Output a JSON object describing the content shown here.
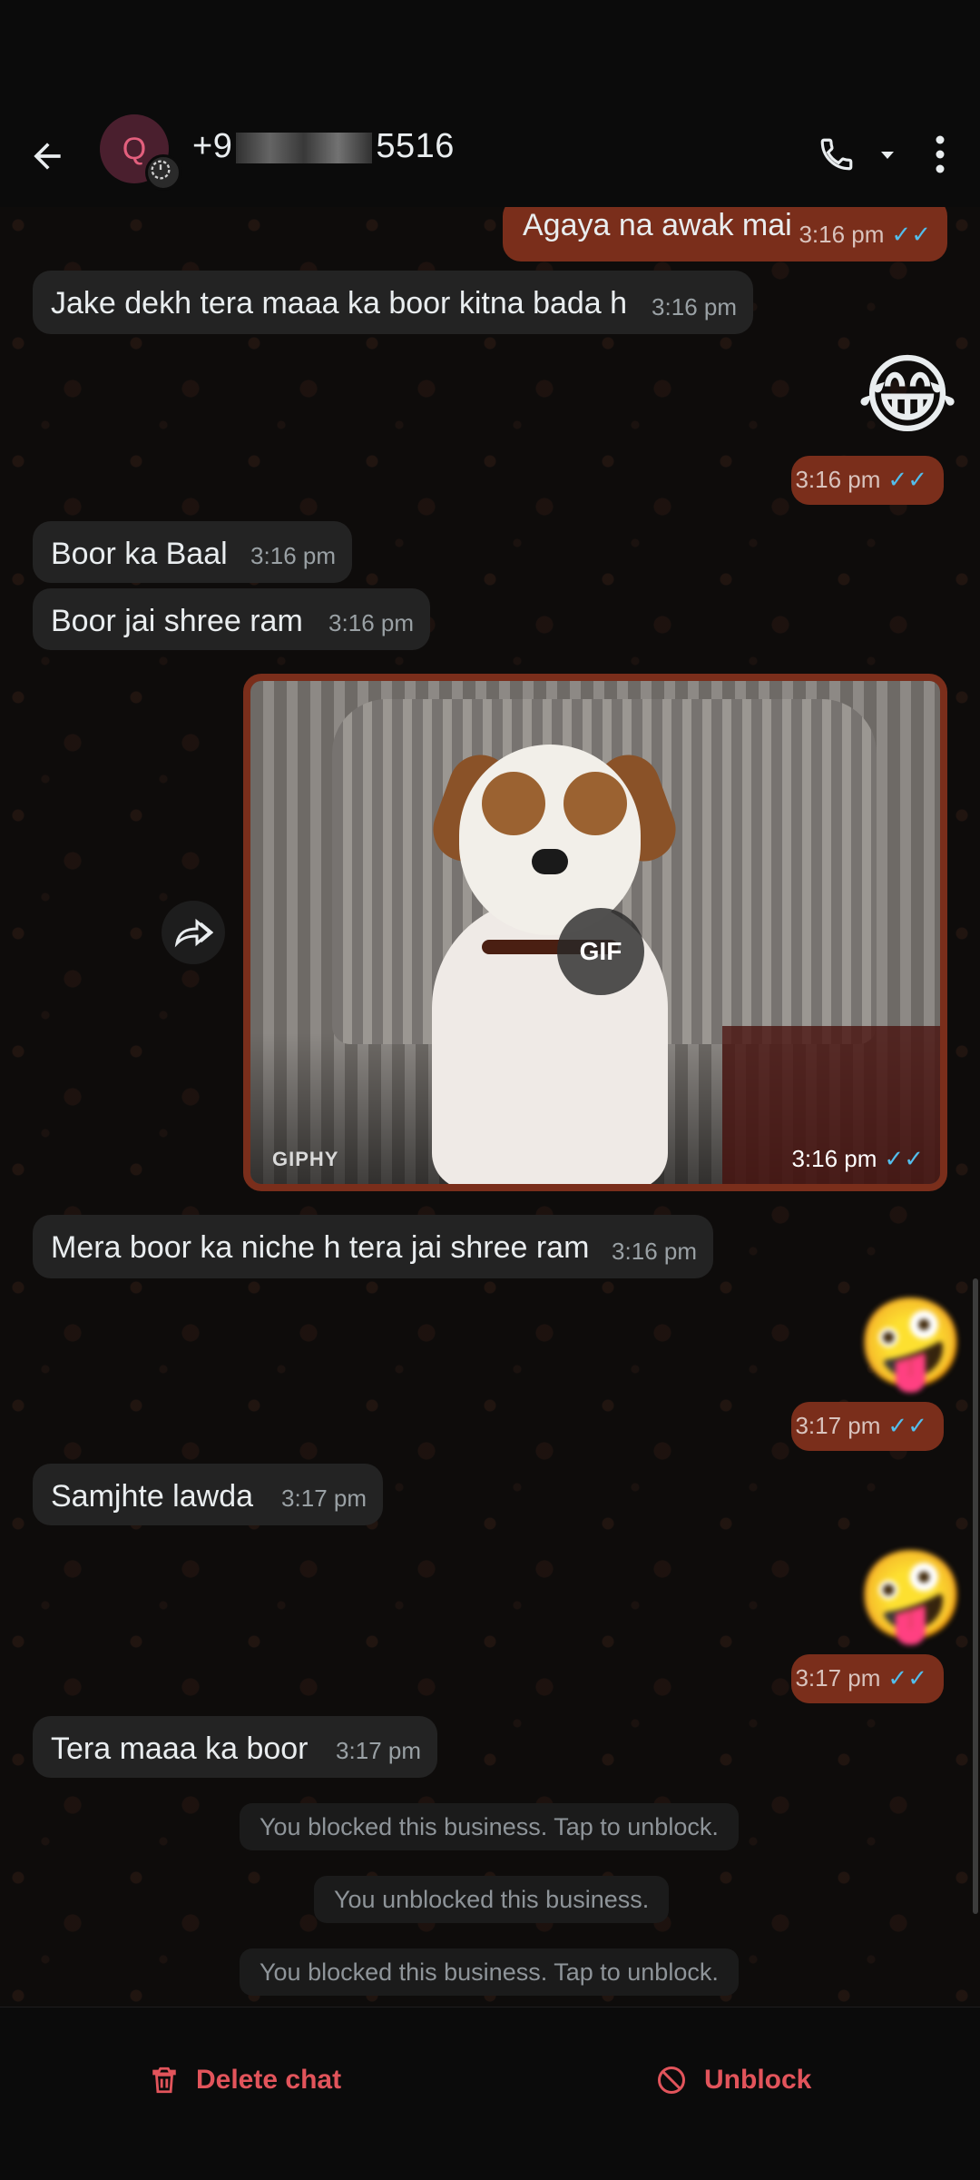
{
  "header": {
    "contact_prefix": "+9",
    "contact_suffix": "5516",
    "avatar_letter": "Q",
    "icons": [
      "back-arrow-icon",
      "phone-icon",
      "dropdown-arrow-icon",
      "more-options-icon"
    ]
  },
  "messages": [
    {
      "dir": "out",
      "text": "Agaya na awak mai",
      "time": "3:16 pm",
      "read": true
    },
    {
      "dir": "in",
      "text": "Jake dekh tera maaa ka boor kitna bada h",
      "time": "3:16 pm"
    },
    {
      "dir": "out",
      "emoji": "😂",
      "time": "3:16 pm",
      "read": true
    },
    {
      "dir": "in",
      "text": "Boor ka Baal",
      "time": "3:16 pm"
    },
    {
      "dir": "in",
      "text": "Boor jai shree ram",
      "time": "3:16 pm"
    },
    {
      "dir": "out",
      "media": "gif",
      "badge": "GIF",
      "source": "GIPHY",
      "time": "3:16 pm",
      "read": true
    },
    {
      "dir": "in",
      "text": "Mera boor ka niche h tera jai shree ram",
      "time": "3:16 pm"
    },
    {
      "dir": "out",
      "emoji": "🤪",
      "time": "3:17 pm",
      "read": true
    },
    {
      "dir": "in",
      "text": "Samjhte lawda",
      "time": "3:17 pm"
    },
    {
      "dir": "out",
      "emoji": "🤪",
      "time": "3:17 pm",
      "read": true
    },
    {
      "dir": "in",
      "text": "Tera maaa ka boor",
      "time": "3:17 pm"
    }
  ],
  "system_notices": [
    "You blocked this business. Tap to unblock.",
    "You unblocked this business.",
    "You blocked this business. Tap to unblock."
  ],
  "footer": {
    "delete_label": "Delete chat",
    "unblock_label": "Unblock"
  },
  "colors": {
    "accent_out": "#7a2e1b",
    "bubble_in": "#232323",
    "action_red": "#e2545b",
    "read_tick": "#53bdeb"
  }
}
